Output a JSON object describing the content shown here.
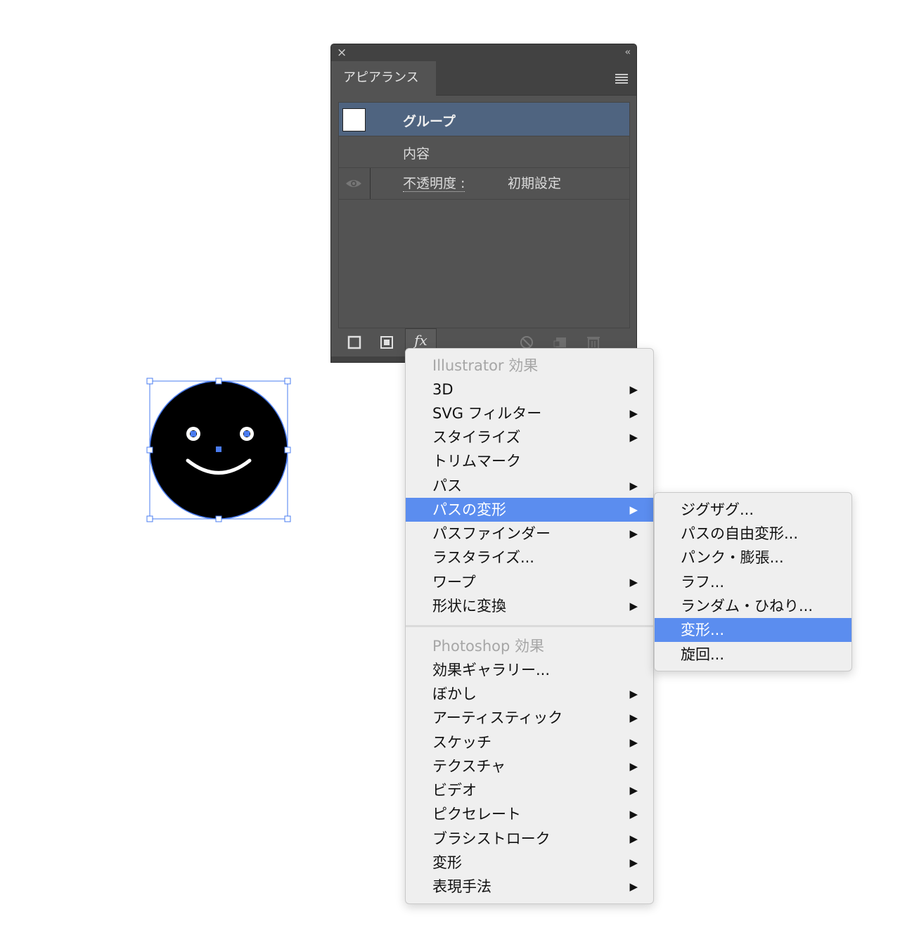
{
  "panel": {
    "close_glyph": "×",
    "collapse_glyph": "‹‹",
    "tab_label": "アピアランス",
    "rows": {
      "group_label": "グループ",
      "content_label": "内容",
      "opacity_label": "不透明度 :",
      "opacity_value": "初期設定"
    },
    "fx_label": "fx"
  },
  "main_menu": {
    "items": [
      {
        "label": "Illustrator 効果",
        "type": "header"
      },
      {
        "label": "3D",
        "submenu": true
      },
      {
        "label": "SVG フィルター",
        "submenu": true
      },
      {
        "label": "スタイライズ",
        "submenu": true
      },
      {
        "label": "トリムマーク",
        "submenu": false
      },
      {
        "label": "パス",
        "submenu": true
      },
      {
        "label": "パスの変形",
        "submenu": true,
        "highlighted": true
      },
      {
        "label": "パスファインダー",
        "submenu": true
      },
      {
        "label": "ラスタライズ...",
        "submenu": false
      },
      {
        "label": "ワープ",
        "submenu": true
      },
      {
        "label": "形状に変換",
        "submenu": true
      },
      {
        "label": "Photoshop 効果",
        "type": "header"
      },
      {
        "label": "効果ギャラリー...",
        "submenu": false
      },
      {
        "label": "ぼかし",
        "submenu": true
      },
      {
        "label": "アーティスティック",
        "submenu": true
      },
      {
        "label": "スケッチ",
        "submenu": true
      },
      {
        "label": "テクスチャ",
        "submenu": true
      },
      {
        "label": "ビデオ",
        "submenu": true
      },
      {
        "label": "ピクセレート",
        "submenu": true
      },
      {
        "label": "ブラシストローク",
        "submenu": true
      },
      {
        "label": "変形",
        "submenu": true
      },
      {
        "label": "表現手法",
        "submenu": true
      }
    ],
    "arrow_glyph": "▶"
  },
  "sub_menu": {
    "items": [
      {
        "label": "ジグザグ..."
      },
      {
        "label": "パスの自由変形..."
      },
      {
        "label": "パンク・膨張..."
      },
      {
        "label": "ラフ..."
      },
      {
        "label": "ランダム・ひねり..."
      },
      {
        "label": "変形...",
        "highlighted": true
      },
      {
        "label": "旋回..."
      }
    ]
  },
  "colors": {
    "highlight": "#5b8def",
    "selection": "#4a7cf0",
    "panel_bg": "#535353",
    "selected_row": "#4f6480"
  }
}
